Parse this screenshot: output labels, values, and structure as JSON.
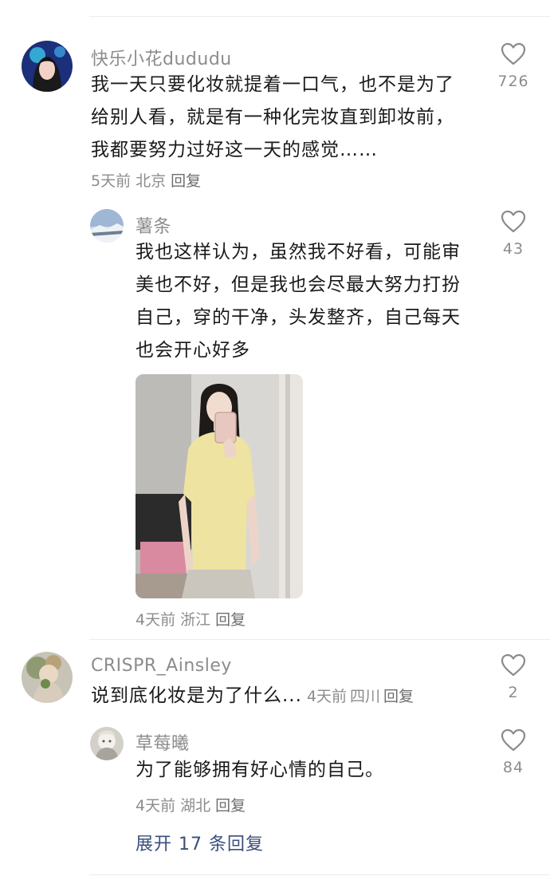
{
  "comments": [
    {
      "username": "快乐小花dududu",
      "lines": [
        "我一天只要化妆就提着一口气，也不是为了",
        "给别人看，就是有一种化完妆直到卸妆前，",
        "我都要努力过好这一天的感觉……"
      ],
      "time": "5天前",
      "location": "北京",
      "reply": "回复",
      "likes": "726",
      "reply_thread": {
        "username": "薯条",
        "lines": [
          "我也这样认为，虽然我不好看，可能审",
          "美也不好，但是我也会尽最大努力打扮",
          "自己，穿的干净，头发整齐，自己每天",
          "也会开心好多"
        ],
        "time": "4天前",
        "location": "浙江",
        "reply": "回复",
        "likes": "43"
      }
    },
    {
      "username": "CRISPR_Ainsley",
      "text": "说到底化妆是为了什么...",
      "time": "4天前",
      "location": "四川",
      "reply": "回复",
      "likes": "2",
      "reply_thread": {
        "username": "草莓曦",
        "text": "为了能够拥有好心情的自己。",
        "time": "4天前",
        "location": "湖北",
        "reply": "回复",
        "likes": "84"
      },
      "expand_label": "展开 17 条回复"
    }
  ],
  "colors": {
    "meta": "#8c8c8c",
    "expand": "#3a4f7a",
    "divider": "#ececec"
  },
  "icons": {
    "like": "heart-outline-icon"
  }
}
